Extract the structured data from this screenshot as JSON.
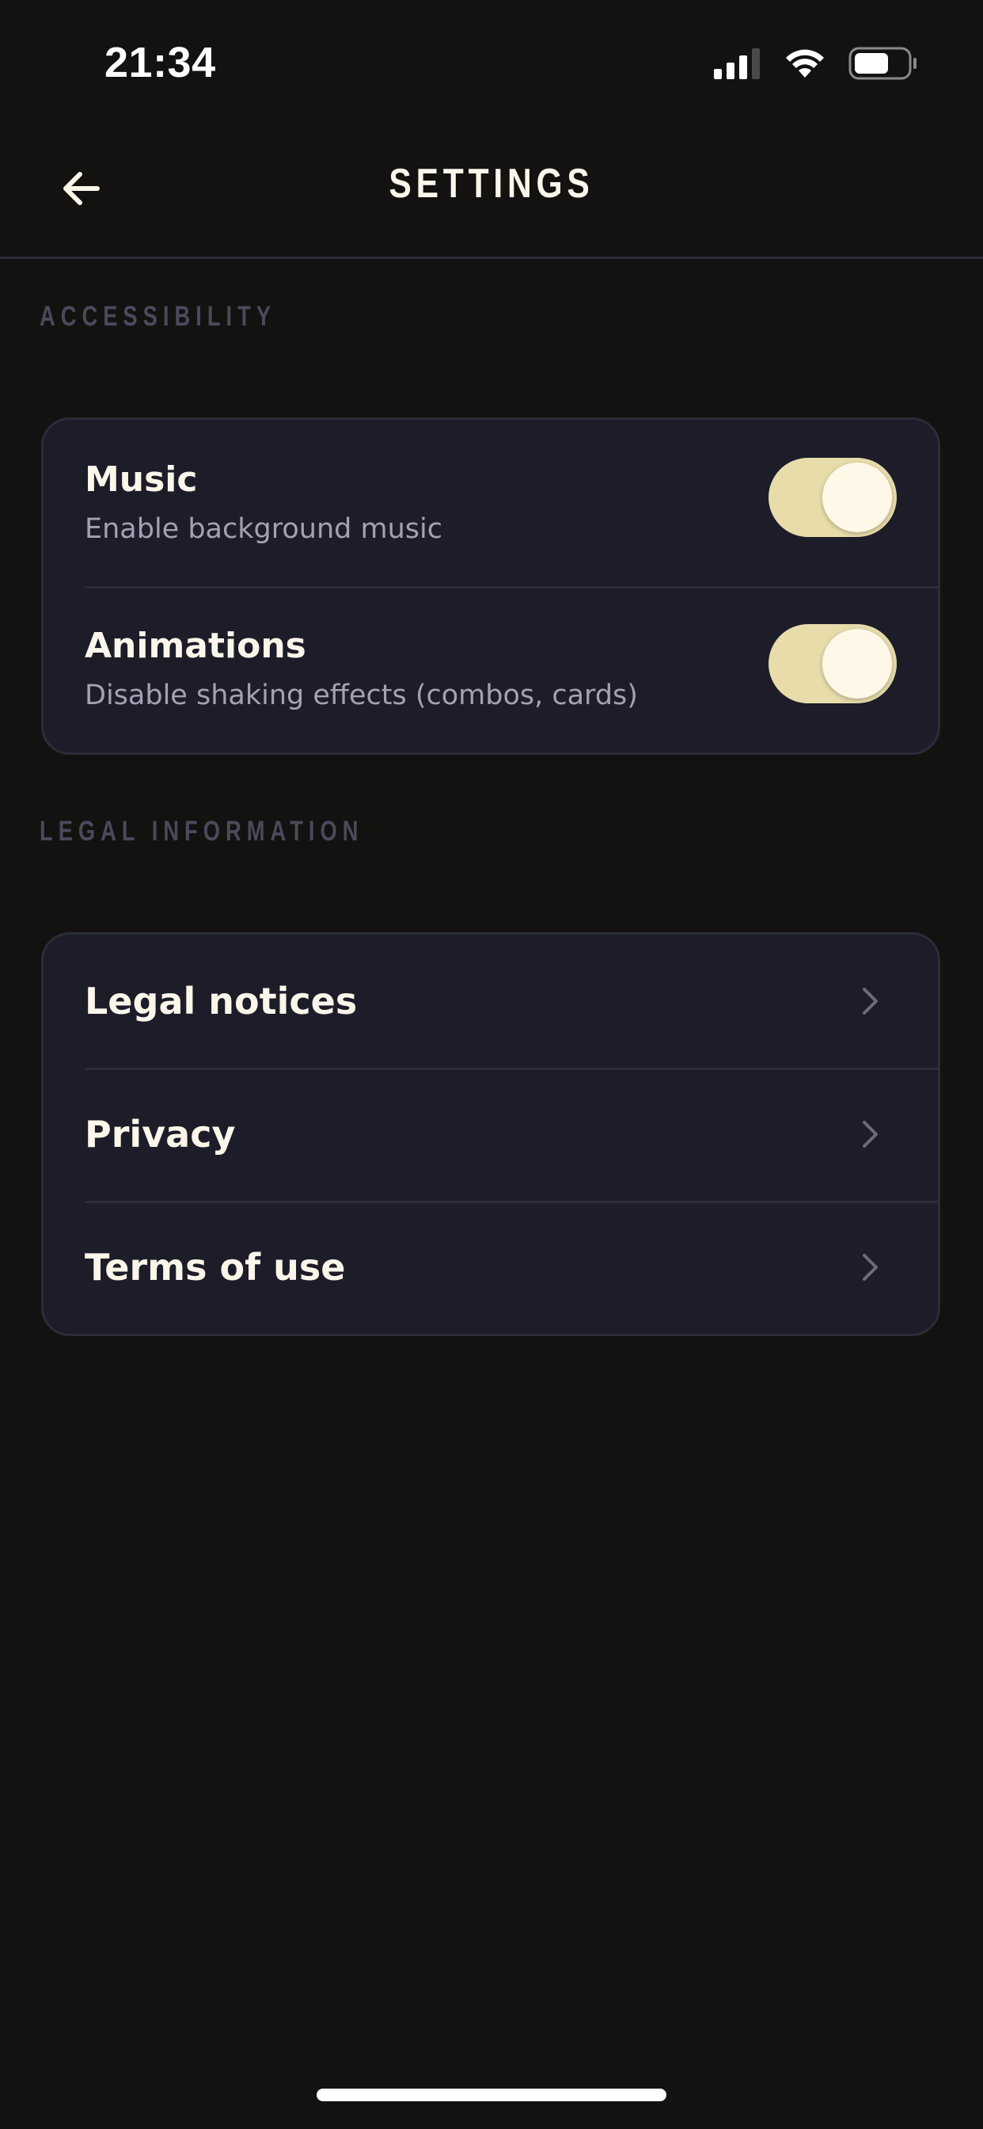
{
  "status_bar": {
    "time": "21:34",
    "icons": [
      "cellular-signal-icon",
      "wifi-icon",
      "battery-icon"
    ],
    "battery_level": 0.6
  },
  "header": {
    "title": "SETTINGS",
    "back_icon": "arrow-left-icon"
  },
  "sections": {
    "accessibility": {
      "label": "ACCESSIBILITY",
      "items": [
        {
          "title": "Music",
          "subtitle": "Enable background music",
          "enabled": true
        },
        {
          "title": "Animations",
          "subtitle": "Disable shaking effects (combos, cards)",
          "enabled": true
        }
      ]
    },
    "legal": {
      "label": "LEGAL INFORMATION",
      "items": [
        {
          "label": "Legal notices",
          "icon": "chevron-right-icon"
        },
        {
          "label": "Privacy",
          "icon": "chevron-right-icon"
        },
        {
          "label": "Terms of use",
          "icon": "chevron-right-icon"
        }
      ]
    }
  },
  "colors": {
    "background": "#131210",
    "card": "#1d1d29",
    "toggle_on": "#e7dcaa",
    "section_label": "#4a4a5c",
    "text_primary": "#fbf6ea",
    "text_secondary": "#a3a1b3"
  }
}
